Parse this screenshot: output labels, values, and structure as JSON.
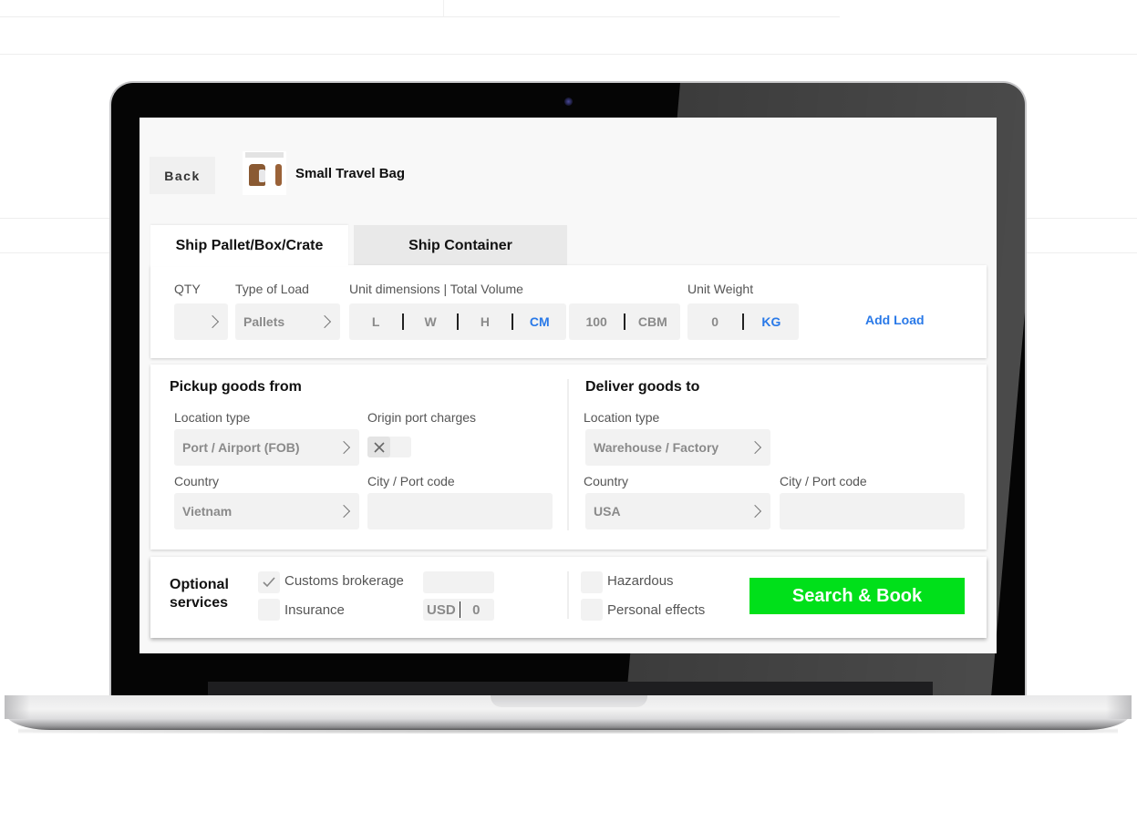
{
  "product": {
    "back_label": "Back",
    "title": "Small Travel Bag"
  },
  "tabs": [
    {
      "label": "Ship Pallet/Box/Crate",
      "active": true
    },
    {
      "label": "Ship Container",
      "active": false
    }
  ],
  "load": {
    "qty_label": "QTY",
    "qty_value": "",
    "type_label": "Type of Load",
    "type_value": "Pallets",
    "dims_label": "Unit dimensions | Total Volume",
    "dim_l": "L",
    "dim_w": "W",
    "dim_h": "H",
    "dim_unit": "CM",
    "volume_value": "100",
    "volume_unit": "CBM",
    "weight_label": "Unit Weight",
    "weight_value": "0",
    "weight_unit": "KG",
    "add_load_label": "Add Load"
  },
  "pickup": {
    "title": "Pickup goods from",
    "location_type_label": "Location type",
    "location_type_value": "Port / Airport (FOB)",
    "origin_charges_label": "Origin port charges",
    "origin_charges_enabled": false,
    "country_label": "Country",
    "country_value": "Vietnam",
    "city_label": "City / Port code",
    "city_value": ""
  },
  "deliver": {
    "title": "Deliver goods to",
    "location_type_label": "Location type",
    "location_type_value": "Warehouse / Factory",
    "country_label": "Country",
    "country_value": "USA",
    "city_label": "City / Port code",
    "city_value": ""
  },
  "optional": {
    "title_line1": "Optional",
    "title_line2": "services",
    "customs_label": "Customs brokerage",
    "customs_checked": true,
    "customs_value": "",
    "insurance_label": "Insurance",
    "insurance_checked": false,
    "insurance_currency": "USD",
    "insurance_value": "0",
    "hazardous_label": "Hazardous",
    "hazardous_checked": false,
    "personal_label": "Personal effects",
    "personal_checked": false
  },
  "actions": {
    "search_book_label": "Search & Book"
  },
  "colors": {
    "accent_blue": "#2979e8",
    "cta_green": "#00e01a"
  }
}
